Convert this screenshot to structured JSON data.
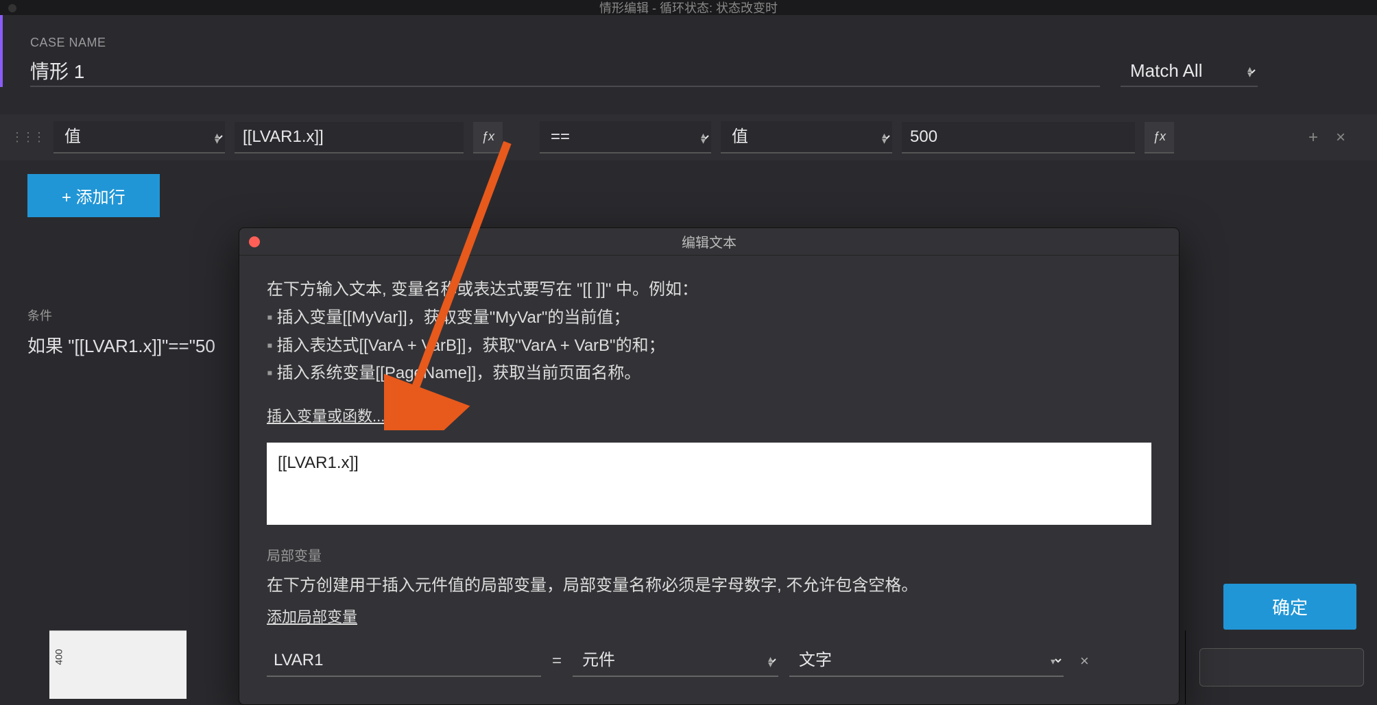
{
  "window": {
    "title": "情形编辑  -  循环状态: 状态改变时"
  },
  "case": {
    "label": "CASE NAME",
    "name": "情形 1",
    "match_mode": "Match All"
  },
  "condition_row": {
    "left_type": "值",
    "left_value": "[[LVAR1.x]]",
    "operator": "==",
    "right_type": "值",
    "right_value": "500"
  },
  "buttons": {
    "add_row": "+ 添加行",
    "ok": "确定",
    "fx": "ƒx"
  },
  "conditions": {
    "label": "条件",
    "summary": "如果 \"[[LVAR1.x]]\"==\"50"
  },
  "modal": {
    "title": "编辑文本",
    "desc_line1": "在下方输入文本, 变量名称或表达式要写在 \"[[ ]]\" 中。例如：",
    "bullet1": "插入变量[[MyVar]]，获取变量\"MyVar\"的当前值；",
    "bullet2": "插入表达式[[VarA + VarB]]，获取\"VarA + VarB\"的和；",
    "bullet3": "插入系统变量[[PageName]]，获取当前页面名称。",
    "insert_link": "插入变量或函数...",
    "expression": "[[LVAR1.x]]",
    "local_var_label": "局部变量",
    "local_var_desc": "在下方创建用于插入元件值的局部变量，局部变量名称必须是字母数字, 不允许包含空格。",
    "add_local_link": "添加局部变量",
    "local_var": {
      "name": "LVAR1",
      "equals": "=",
      "source": "元件",
      "prop": "文字"
    }
  },
  "ruler": {
    "value": "400"
  }
}
